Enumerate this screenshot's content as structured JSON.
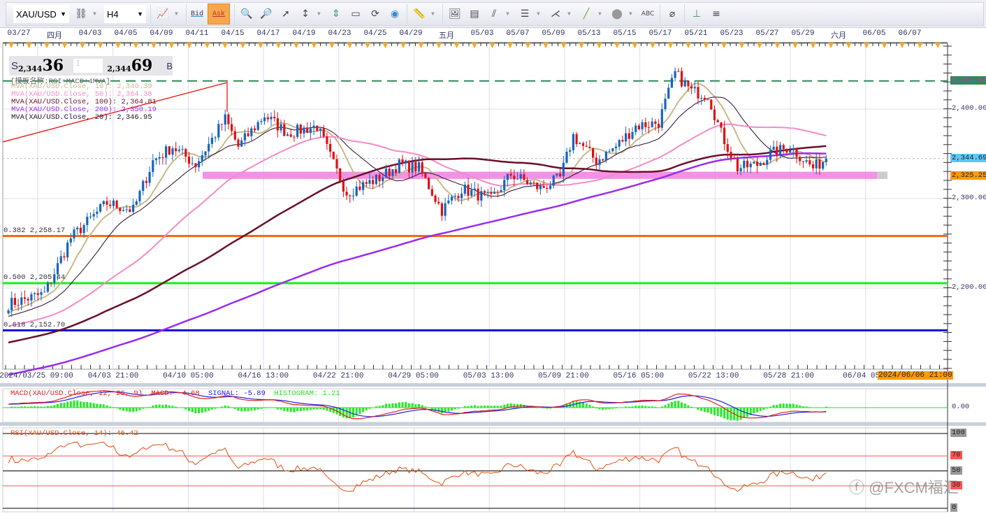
{
  "toolbar": {
    "symbol": "XAU/USD",
    "timeframe": "H4",
    "bid_label": "Bid",
    "ask_label": "Ask"
  },
  "top_dates": [
    "03/27",
    "四月",
    "04/03",
    "04/05",
    "04/09",
    "04/11",
    "04/15",
    "04/17",
    "04/19",
    "04/23",
    "04/25",
    "04/29",
    "五月",
    "05/03",
    "05/07",
    "05/09",
    "05/13",
    "05/15",
    "05/17",
    "05/21",
    "05/23",
    "05/27",
    "05/29",
    "六月",
    "06/05",
    "06/07"
  ],
  "bottom_dates": [
    "2024/03/25 09:00",
    "04/03 21:00",
    "04/10 05:00",
    "04/16 13:00",
    "04/22 21:00",
    "04/29 05:00",
    "05/03 13:00",
    "05/09 21:00",
    "05/16 05:00",
    "05/22 13:00",
    "05/28 21:00",
    "06/04 05:"
  ],
  "cursor_date": "2024/06/06 21:00",
  "quote": {
    "sell_label": "S",
    "sell_small": "2,344",
    "sell_big": "36",
    "amount": "1",
    "buy_small": "2,344",
    "buy_big": "69",
    "buy_label": "B"
  },
  "legend": {
    "template": "[模板名称:RSI+MACD+4MVA]",
    "ma": [
      {
        "text": "MVA(XAU/USD.Close, 10): 2,340.39",
        "color": "#c8b98a"
      },
      {
        "text": "MVA(XAU/USD.Close, 50): 2,364.38",
        "color": "#f58ac8"
      },
      {
        "text": "MVA(XAU/USD.Close, 100): 2,364.81",
        "color": "#6a0f2a"
      },
      {
        "text": "MVA(XAU/USD.Close, 200): 2,350.19",
        "color": "#9a2cf0"
      },
      {
        "text": "MVA(XAU/USD.Close, 20): 2,346.95",
        "color": "#2a0a2a"
      }
    ]
  },
  "fib": [
    {
      "label": "0.382 2,258.17",
      "price": 2258.17,
      "color": "#f26b0f"
    },
    {
      "label": "0.500 2,205.44",
      "price": 2205.44,
      "color": "#18ee18"
    },
    {
      "label": "0.618 2,152.70",
      "price": 2152.7,
      "color": "#1010e0"
    }
  ],
  "price_axis": {
    "ticks": [
      "2,400.00",
      "2,300.00",
      "2,200.00"
    ],
    "tick_values": [
      2400,
      2300,
      2200
    ],
    "marks": [
      {
        "text": "2,431.43",
        "price": 2431.43,
        "bg": "#2e8b57",
        "fg": "#e020e0"
      },
      {
        "text": "2,344.69",
        "price": 2344.69,
        "bg": "#5bc8f5",
        "fg": "#223"
      },
      {
        "text": "2,325.25",
        "price": 2325.25,
        "bg": "#ff9900",
        "fg": "#223"
      }
    ]
  },
  "macd": {
    "title": "MACD(XAU/USD.Close, 12, 26, 9)",
    "macd": "MACD: -4.68",
    "signal": "SIGNAL: -5.89",
    "histogram": "HISTOGRAM: 1.21",
    "axis": "0.00"
  },
  "rsi": {
    "title": "RSI(XAU/USD.Close, 14): 46.42",
    "levels": [
      "100",
      "70",
      "50",
      "30",
      "0"
    ]
  },
  "watermark": "@FXCM福汇",
  "chart_data": {
    "type": "candlestick",
    "symbol": "XAU/USD",
    "timeframe": "H4",
    "bars": 250,
    "ylim": [
      2120,
      2480
    ],
    "history_start_price": 2030,
    "close_keypoints": [
      [
        0,
        2182
      ],
      [
        11,
        2194
      ],
      [
        19,
        2256
      ],
      [
        30,
        2295
      ],
      [
        38,
        2287
      ],
      [
        44,
        2342
      ],
      [
        50,
        2358
      ],
      [
        57,
        2338
      ],
      [
        66,
        2389
      ],
      [
        70,
        2358
      ],
      [
        78,
        2393
      ],
      [
        85,
        2373
      ],
      [
        94,
        2381
      ],
      [
        100,
        2330
      ],
      [
        103,
        2307
      ],
      [
        113,
        2323
      ],
      [
        119,
        2338
      ],
      [
        125,
        2334
      ],
      [
        132,
        2287
      ],
      [
        138,
        2311
      ],
      [
        147,
        2299
      ],
      [
        153,
        2327
      ],
      [
        162,
        2311
      ],
      [
        168,
        2323
      ],
      [
        172,
        2370
      ],
      [
        179,
        2342
      ],
      [
        185,
        2358
      ],
      [
        191,
        2381
      ],
      [
        198,
        2385
      ],
      [
        203,
        2440
      ],
      [
        208,
        2420
      ],
      [
        213,
        2416
      ],
      [
        217,
        2373
      ],
      [
        222,
        2334
      ],
      [
        228,
        2338
      ],
      [
        232,
        2350
      ],
      [
        238,
        2358
      ],
      [
        245,
        2334
      ],
      [
        249,
        2344.69
      ]
    ],
    "moving_averages": [
      10,
      20,
      50,
      100,
      200
    ],
    "support_band": [
      2322,
      2330
    ],
    "resistance_dashed": 2431.43
  }
}
